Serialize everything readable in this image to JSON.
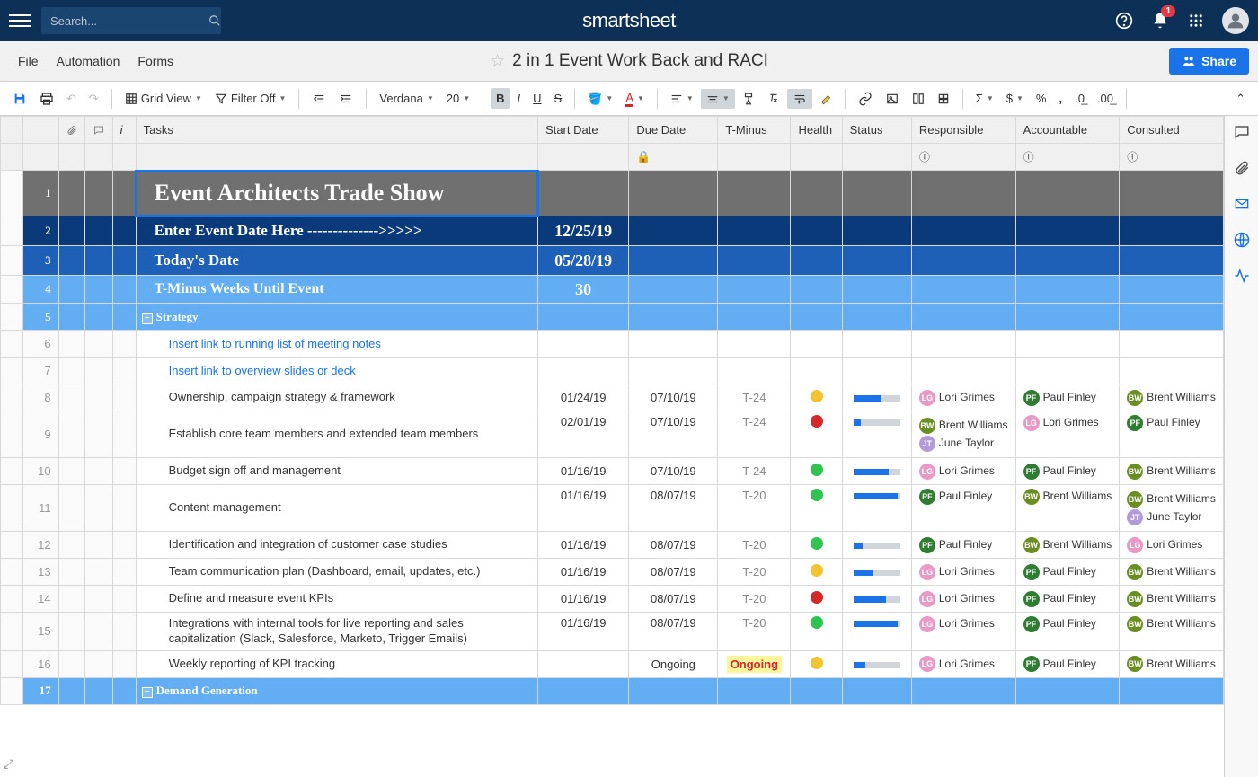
{
  "topbar": {
    "search_placeholder": "Search...",
    "brand": "smartsheet",
    "notif_count": "1"
  },
  "menubar": {
    "file": "File",
    "automation": "Automation",
    "forms": "Forms",
    "sheet_title": "2 in 1 Event Work Back and RACI",
    "share": "Share"
  },
  "toolbar": {
    "grid_view": "Grid View",
    "filter_off": "Filter Off",
    "font": "Verdana",
    "size": "20"
  },
  "columns": {
    "tasks": "Tasks",
    "start": "Start Date",
    "due": "Due Date",
    "tminus": "T-Minus",
    "health": "Health",
    "status": "Status",
    "responsible": "Responsible",
    "accountable": "Accountable",
    "consulted": "Consulted"
  },
  "rows": {
    "banner": "Event Architects Trade Show",
    "enter_date": "Enter Event Date Here -------------->>>>>",
    "enter_date_val": "12/25/19",
    "today": "Today's Date",
    "today_val": "05/28/19",
    "tminus_label": "T-Minus Weeks Until Event",
    "tminus_val": "30",
    "strategy": "Strategy",
    "link1": "Insert link to running list of meeting notes",
    "link2": "Insert link to overview slides or deck",
    "r8": {
      "task": "Ownership, campaign strategy & framework",
      "start": "01/24/19",
      "due": "07/10/19",
      "tm": "T-24",
      "health": "yellow",
      "prog": 60
    },
    "r9": {
      "task": "Establish core team members and extended team members",
      "start": "02/01/19",
      "due": "07/10/19",
      "tm": "T-24",
      "health": "red",
      "prog": 15
    },
    "r10": {
      "task": "Budget sign off and management",
      "start": "01/16/19",
      "due": "07/10/19",
      "tm": "T-24",
      "health": "green",
      "prog": 75
    },
    "r11": {
      "task": "Content management",
      "start": "01/16/19",
      "due": "08/07/19",
      "tm": "T-20",
      "health": "green",
      "prog": 95
    },
    "r12": {
      "task": "Identification and integration of customer case studies",
      "start": "01/16/19",
      "due": "08/07/19",
      "tm": "T-20",
      "health": "green",
      "prog": 20
    },
    "r13": {
      "task": "Team communication plan (Dashboard, email, updates, etc.)",
      "start": "01/16/19",
      "due": "08/07/19",
      "tm": "T-20",
      "health": "yellow",
      "prog": 40
    },
    "r14": {
      "task": "Define and measure event KPIs",
      "start": "01/16/19",
      "due": "08/07/19",
      "tm": "T-20",
      "health": "red",
      "prog": 70
    },
    "r15": {
      "task": "Integrations with internal tools for live reporting and sales capitalization (Slack, Salesforce, Marketo, Trigger Emails)",
      "start": "01/16/19",
      "due": "08/07/19",
      "tm": "T-20",
      "health": "green",
      "prog": 95
    },
    "r16": {
      "task": "Weekly reporting of KPI tracking",
      "due": "Ongoing",
      "tm": "Ongoing",
      "health": "yellow",
      "prog": 25
    },
    "demand_gen": "Demand Generation"
  },
  "people": {
    "lg": {
      "initials": "LG",
      "name": "Lori Grimes"
    },
    "pf": {
      "initials": "PF",
      "name": "Paul Finley"
    },
    "bw": {
      "initials": "BW",
      "name": "Brent Williams"
    },
    "jt": {
      "initials": "JT",
      "name": "June Taylor"
    }
  }
}
